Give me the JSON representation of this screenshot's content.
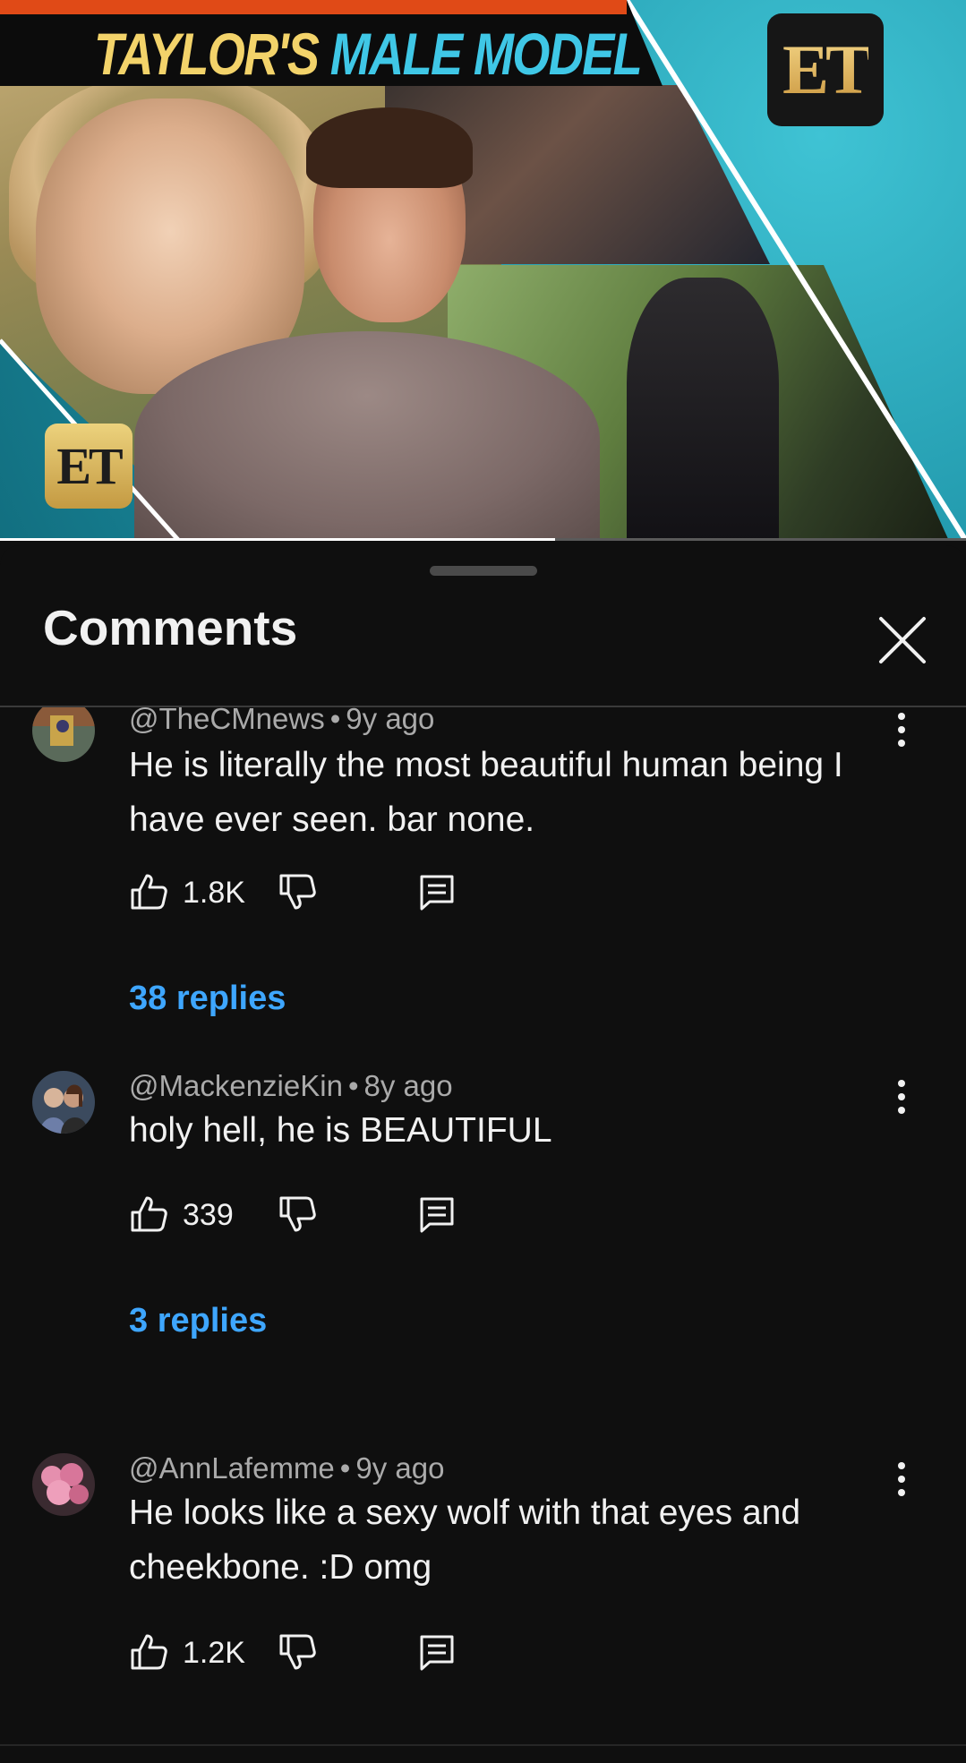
{
  "video": {
    "title_part1": "TAYLOR'S",
    "title_part2": "MALE MODEL",
    "channel_logo": "ET",
    "badge_logo": "ET",
    "progress": 0.575
  },
  "comments_panel": {
    "title": "Comments",
    "close_icon": "close-icon"
  },
  "comments": [
    {
      "author": "@TheCMnews",
      "age": "9y ago",
      "text": "He is literally the most beautiful human being I have ever seen. bar none.",
      "likes": "1.8K",
      "replies": "38 replies"
    },
    {
      "author": "@MackenzieKin",
      "age": "8y ago",
      "text": "holy hell, he is BEAUTIFUL",
      "likes": "339",
      "replies": "3 replies"
    },
    {
      "author": "@AnnLafemme",
      "age": "9y ago",
      "text": "He looks like a sexy wolf with that eyes and cheekbone. :D omg",
      "likes": "1.2K",
      "replies": ""
    }
  ],
  "colors": {
    "background": "#0f0f0f",
    "link_blue": "#3ea6ff",
    "secondary_text": "#aaaaaa"
  }
}
